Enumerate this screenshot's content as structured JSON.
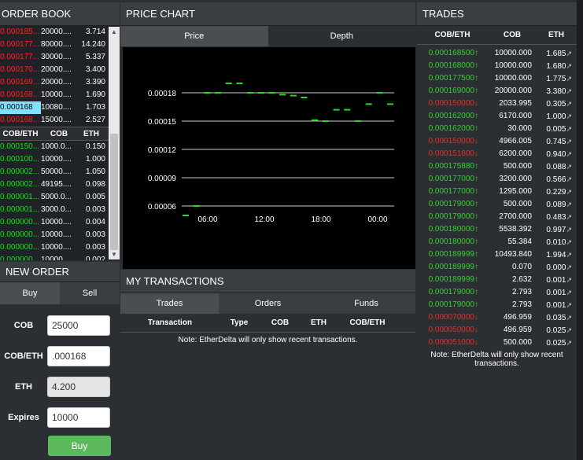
{
  "order_book": {
    "title": "ORDER BOOK",
    "sells": [
      [
        "0.000185...",
        "20000....",
        "3.714"
      ],
      [
        "0.000177...",
        "80000....",
        "14.240"
      ],
      [
        "0.000177...",
        "30000....",
        "5.337"
      ],
      [
        "0.000170...",
        "20000....",
        "3.400"
      ],
      [
        "0.000169...",
        "20000....",
        "3.390"
      ],
      [
        "0.000168...",
        "10000....",
        "1.690"
      ],
      [
        "0.000168",
        "10080....",
        "1.703"
      ],
      [
        "0.000168...",
        "15000....",
        "2.527"
      ]
    ],
    "columns": [
      "COB/ETH",
      "COB",
      "ETH"
    ],
    "buys": [
      [
        "0.000150...",
        "1000.0...",
        "0.150"
      ],
      [
        "0.000100...",
        "10000....",
        "1.000"
      ],
      [
        "0.000002...",
        "50000....",
        "1.050"
      ],
      [
        "0.000002...",
        "49195....",
        "0.098"
      ],
      [
        "0.000001...",
        "5000.0...",
        "0.005"
      ],
      [
        "0.000001...",
        "3000.0...",
        "0.003"
      ],
      [
        "0.000000...",
        "10000....",
        "0.004"
      ],
      [
        "0.000000...",
        "10000....",
        "0.003"
      ],
      [
        "0.000000...",
        "10000....",
        "0.003"
      ],
      [
        "0.000000...",
        "10000....",
        "0.002"
      ]
    ]
  },
  "new_order": {
    "title": "NEW ORDER",
    "tab_buy": "Buy",
    "tab_sell": "Sell",
    "cob_label": "COB",
    "cob_value": "25000",
    "price_label": "COB/ETH",
    "price_value": ".000168",
    "eth_label": "ETH",
    "eth_value": "4.200",
    "expires_label": "Expires",
    "expires_value": "10000",
    "submit_label": "Buy"
  },
  "price_chart": {
    "title": "PRICE CHART",
    "tab_price": "Price",
    "tab_depth": "Depth"
  },
  "chart_data": {
    "type": "line",
    "y_ticks": [
      "0.00018",
      "0.00015",
      "0.00012",
      "0.00009",
      "0.00006"
    ],
    "x_ticks": [
      "06:00",
      "12:00",
      "18:00",
      "00:00"
    ],
    "ylim": [
      4.5e-05,
      0.000195
    ],
    "values": [
      5e-05,
      6e-05,
      0.00018,
      0.00018,
      0.00019,
      0.00019,
      0.00018,
      0.00018,
      0.00018,
      0.000178,
      0.000177,
      0.000175,
      0.000151,
      0.00015,
      0.000162,
      0.000162,
      0.00015,
      0.000168,
      0.00018,
      0.000168
    ],
    "grid": true
  },
  "my_transactions": {
    "title": "MY TRANSACTIONS",
    "tab_trades": "Trades",
    "tab_orders": "Orders",
    "tab_funds": "Funds",
    "columns": [
      "Transaction",
      "Type",
      "COB",
      "ETH",
      "COB/ETH"
    ],
    "note": "Note: EtherDelta will only show recent transactions."
  },
  "trades": {
    "title": "TRADES",
    "columns": [
      "COB/ETH",
      "COB",
      "ETH"
    ],
    "rows": [
      {
        "price": "0.000168500",
        "cob": "10000.000",
        "eth": "1.685",
        "side": "up"
      },
      {
        "price": "0.000168000",
        "cob": "10000.000",
        "eth": "1.680",
        "side": "up"
      },
      {
        "price": "0.000177500",
        "cob": "10000.000",
        "eth": "1.775",
        "side": "up"
      },
      {
        "price": "0.000169000",
        "cob": "20000.000",
        "eth": "3.380",
        "side": "up"
      },
      {
        "price": "0.000150000",
        "cob": "2033.995",
        "eth": "0.305",
        "side": "down"
      },
      {
        "price": "0.000162000",
        "cob": "6170.000",
        "eth": "1.000",
        "side": "up"
      },
      {
        "price": "0.000162000",
        "cob": "30.000",
        "eth": "0.005",
        "side": "up"
      },
      {
        "price": "0.000150000",
        "cob": "4966.005",
        "eth": "0.745",
        "side": "down"
      },
      {
        "price": "0.000151600",
        "cob": "6200.000",
        "eth": "0.940",
        "side": "down"
      },
      {
        "price": "0.000175880",
        "cob": "500.000",
        "eth": "0.088",
        "side": "up"
      },
      {
        "price": "0.000177000",
        "cob": "3200.000",
        "eth": "0.566",
        "side": "up"
      },
      {
        "price": "0.000177000",
        "cob": "1295.000",
        "eth": "0.229",
        "side": "up"
      },
      {
        "price": "0.000179000",
        "cob": "500.000",
        "eth": "0.089",
        "side": "up"
      },
      {
        "price": "0.000179000",
        "cob": "2700.000",
        "eth": "0.483",
        "side": "up"
      },
      {
        "price": "0.000180000",
        "cob": "5538.392",
        "eth": "0.997",
        "side": "up"
      },
      {
        "price": "0.000180000",
        "cob": "55.384",
        "eth": "0.010",
        "side": "up"
      },
      {
        "price": "0.000189999",
        "cob": "10493.840",
        "eth": "1.994",
        "side": "up"
      },
      {
        "price": "0.000189999",
        "cob": "0.070",
        "eth": "0.000",
        "side": "up"
      },
      {
        "price": "0.000189999",
        "cob": "2.632",
        "eth": "0.001",
        "side": "up"
      },
      {
        "price": "0.000179000",
        "cob": "2.793",
        "eth": "0.001",
        "side": "up"
      },
      {
        "price": "0.000179000",
        "cob": "2.793",
        "eth": "0.001",
        "side": "up"
      },
      {
        "price": "0.000070000",
        "cob": "496.959",
        "eth": "0.035",
        "side": "down"
      },
      {
        "price": "0.000050000",
        "cob": "496.959",
        "eth": "0.025",
        "side": "down"
      },
      {
        "price": "0.000051000",
        "cob": "500.000",
        "eth": "0.025",
        "side": "down"
      }
    ],
    "note": "Note: EtherDelta will only show recent transactions."
  },
  "colors": {
    "up": "#22dd22",
    "down": "#ff2222",
    "accent": "#5cb85c"
  }
}
